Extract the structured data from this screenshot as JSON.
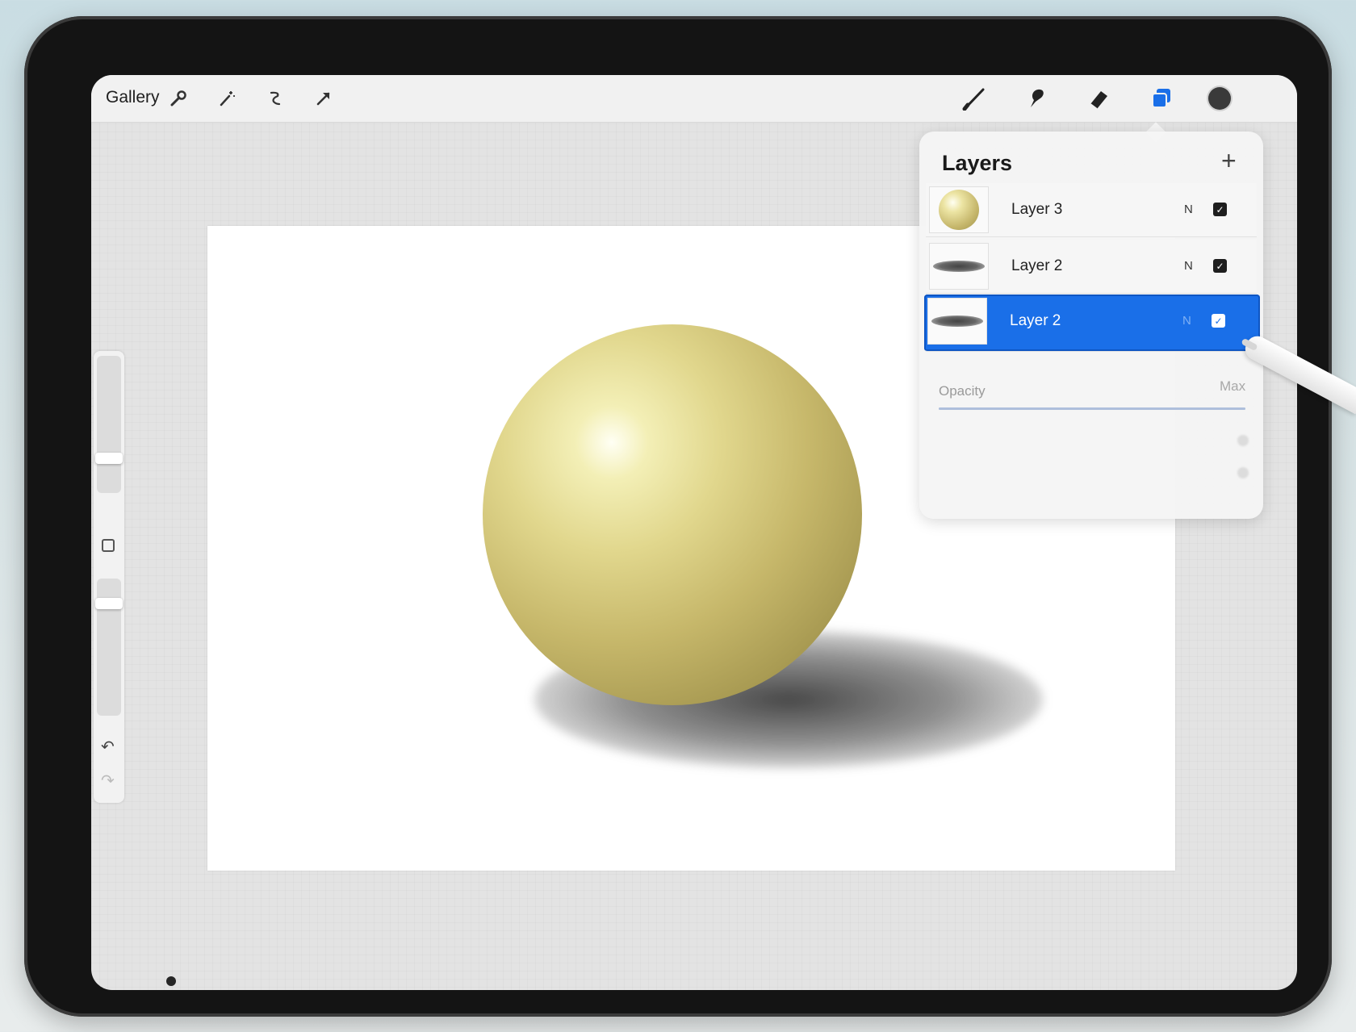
{
  "topbar": {
    "gallery_label": "Gallery",
    "left_tools": [
      "wrench-icon",
      "magic-wand-icon",
      "selection-icon",
      "transform-arrow-icon"
    ],
    "right_tools": [
      "brush-icon",
      "smudge-icon",
      "eraser-icon",
      "layers-icon",
      "color-swatch"
    ],
    "active_tool": "layers-icon",
    "accent_color": "#1a6fe8",
    "current_color": "#3a3a3a"
  },
  "layers_panel": {
    "title": "Layers",
    "add_icon": "plus-icon",
    "layers": [
      {
        "name": "Layer 3",
        "blend": "N",
        "visible": true,
        "selected": false,
        "thumb": "sphere"
      },
      {
        "name": "Layer 2",
        "blend": "N",
        "visible": true,
        "selected": false,
        "thumb": "shadow"
      },
      {
        "name": "Layer 2",
        "blend": "N",
        "visible": true,
        "selected": true,
        "thumb": "shadow"
      }
    ],
    "opacity_label": "Opacity",
    "opacity_value_label": "Max",
    "opacity_fraction": 1.0
  },
  "sidebar": {
    "brush_size_level": 0.7,
    "opacity_level": 0.2,
    "undo_icon": "undo-icon",
    "redo_icon": "redo-icon"
  },
  "canvas": {
    "sphere_color": "#e1d78d",
    "shadow_color": "#404040"
  }
}
